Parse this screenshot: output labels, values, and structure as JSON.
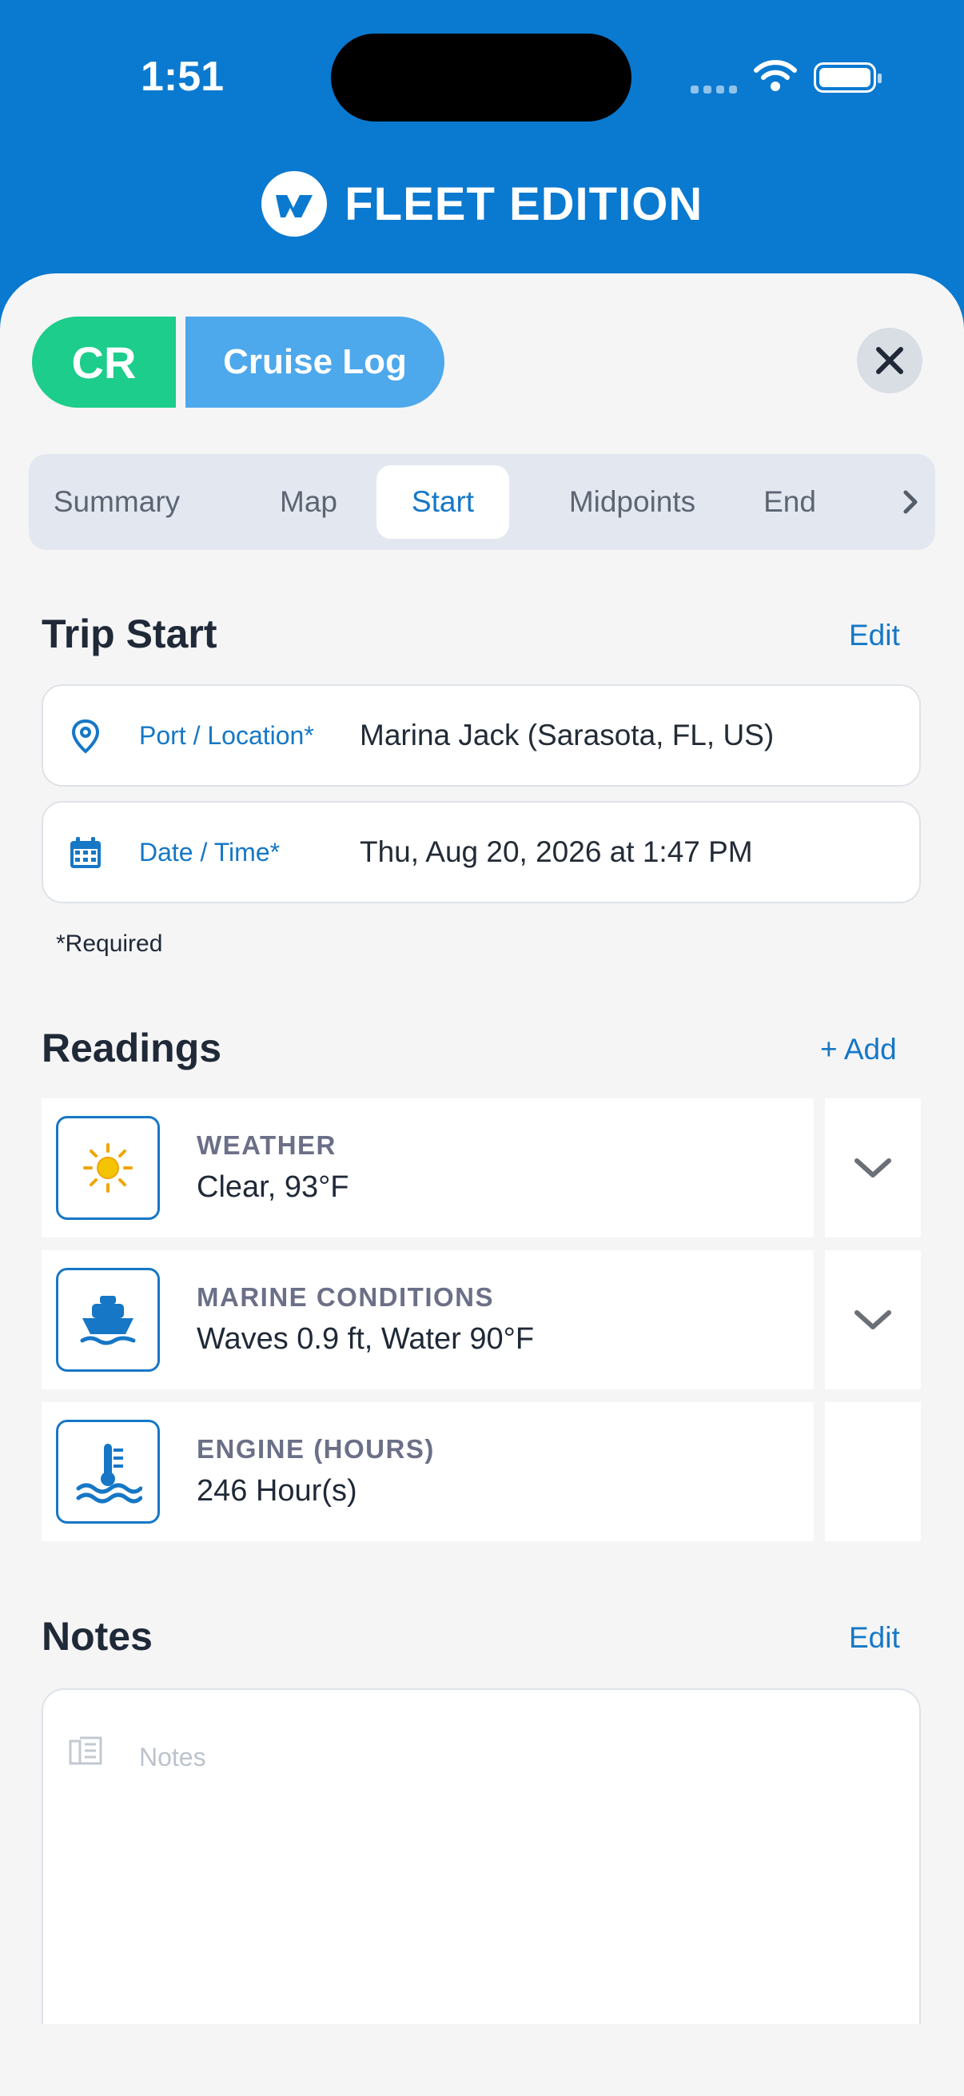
{
  "status": {
    "time": "1:51"
  },
  "brand": {
    "name": "FLEET EDITION"
  },
  "header": {
    "badge": "CR",
    "title": "Cruise Log"
  },
  "tabs": [
    {
      "label": "Summary",
      "active": false
    },
    {
      "label": "Map",
      "active": false
    },
    {
      "label": "Start",
      "active": true
    },
    {
      "label": "Midpoints",
      "active": false
    },
    {
      "label": "End",
      "active": false
    }
  ],
  "trip_start": {
    "title": "Trip Start",
    "edit_label": "Edit",
    "fields": [
      {
        "label": "Port / Location*",
        "value": "Marina Jack (Sarasota, FL, US)",
        "icon": "location-pin-icon"
      },
      {
        "label": "Date / Time*",
        "value": "Thu, Aug 20, 2026 at 1:47 PM",
        "icon": "calendar-icon"
      }
    ],
    "required_note": "*Required"
  },
  "readings": {
    "title": "Readings",
    "add_label": "+ Add",
    "items": [
      {
        "label": "WEATHER",
        "value": "Clear, 93°F",
        "icon": "sun-icon",
        "expandable": true
      },
      {
        "label": "MARINE CONDITIONS",
        "value": "Waves 0.9 ft, Water 90°F",
        "icon": "boat-icon",
        "expandable": true
      },
      {
        "label": "ENGINE (HOURS)",
        "value": "246 Hour(s)",
        "icon": "engine-temp-icon",
        "expandable": false
      }
    ]
  },
  "notes": {
    "title": "Notes",
    "edit_label": "Edit",
    "placeholder": "Notes"
  },
  "colors": {
    "brand_blue": "#0a79d0",
    "accent_green": "#1ccd8b",
    "accent_light_blue": "#4da8ec",
    "link_blue": "#1677c6",
    "sun_yellow": "#f5c400"
  }
}
